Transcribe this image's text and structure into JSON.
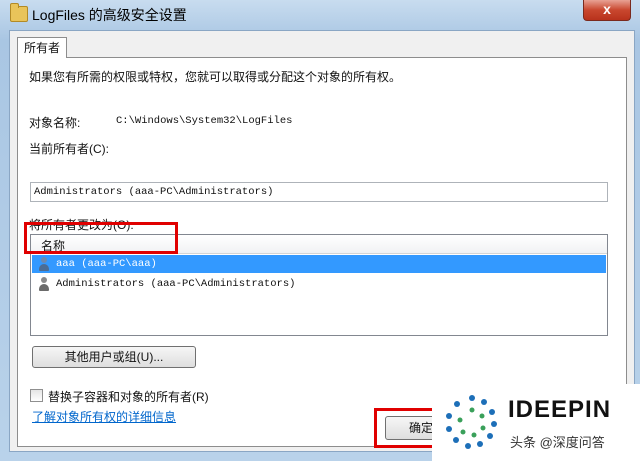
{
  "window": {
    "title": "LogFiles 的高级安全设置",
    "close_label": "x"
  },
  "tab": {
    "label": "所有者"
  },
  "intro_text": "如果您有所需的权限或特权，您就可以取得或分配这个对象的所有权。",
  "object": {
    "label": "对象名称:",
    "value": "C:\\Windows\\System32\\LogFiles"
  },
  "current_owner": {
    "label": "当前所有者(C):",
    "value": "Administrators (aaa-PC\\Administrators)"
  },
  "change_owner": {
    "label": "将所有者更改为(O):",
    "column_header": "名称",
    "rows": [
      {
        "text": "aaa (aaa-PC\\aaa)",
        "selected": true,
        "icon": "user-icon"
      },
      {
        "text": "Administrators (aaa-PC\\Administrators)",
        "selected": false,
        "icon": "group-icon"
      }
    ]
  },
  "other_users_button": "其他用户或组(U)...",
  "replace_checkbox": {
    "label": "替换子容器和对象的所有者(R)",
    "checked": false
  },
  "details_link": "了解对象所有权的详细信息",
  "ok_button": "确定",
  "watermark": {
    "brand": "IDEEPIN",
    "sub": "头条 @深度问答"
  },
  "colors": {
    "highlight": "#e00000",
    "selection": "#3399ff",
    "link": "#0066cc"
  }
}
